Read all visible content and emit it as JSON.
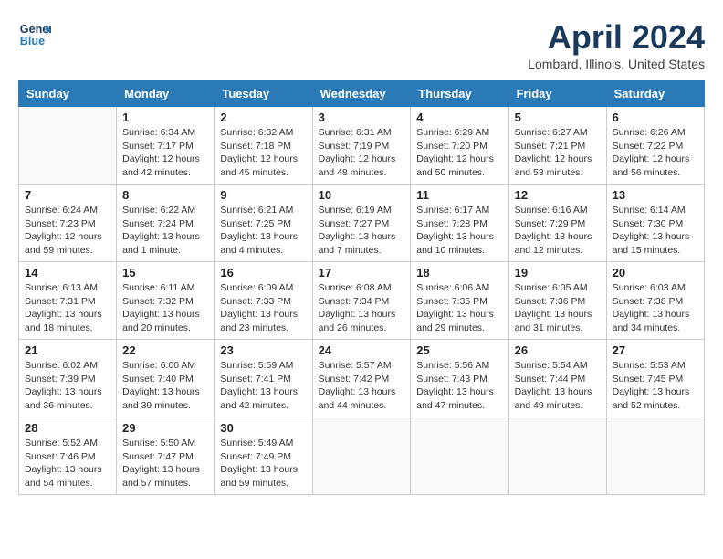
{
  "header": {
    "logo_line1": "General",
    "logo_line2": "Blue",
    "title": "April 2024",
    "location": "Lombard, Illinois, United States"
  },
  "days_of_week": [
    "Sunday",
    "Monday",
    "Tuesday",
    "Wednesday",
    "Thursday",
    "Friday",
    "Saturday"
  ],
  "weeks": [
    [
      {
        "num": "",
        "sunrise": "",
        "sunset": "",
        "daylight": ""
      },
      {
        "num": "1",
        "sunrise": "Sunrise: 6:34 AM",
        "sunset": "Sunset: 7:17 PM",
        "daylight": "Daylight: 12 hours and 42 minutes."
      },
      {
        "num": "2",
        "sunrise": "Sunrise: 6:32 AM",
        "sunset": "Sunset: 7:18 PM",
        "daylight": "Daylight: 12 hours and 45 minutes."
      },
      {
        "num": "3",
        "sunrise": "Sunrise: 6:31 AM",
        "sunset": "Sunset: 7:19 PM",
        "daylight": "Daylight: 12 hours and 48 minutes."
      },
      {
        "num": "4",
        "sunrise": "Sunrise: 6:29 AM",
        "sunset": "Sunset: 7:20 PM",
        "daylight": "Daylight: 12 hours and 50 minutes."
      },
      {
        "num": "5",
        "sunrise": "Sunrise: 6:27 AM",
        "sunset": "Sunset: 7:21 PM",
        "daylight": "Daylight: 12 hours and 53 minutes."
      },
      {
        "num": "6",
        "sunrise": "Sunrise: 6:26 AM",
        "sunset": "Sunset: 7:22 PM",
        "daylight": "Daylight: 12 hours and 56 minutes."
      }
    ],
    [
      {
        "num": "7",
        "sunrise": "Sunrise: 6:24 AM",
        "sunset": "Sunset: 7:23 PM",
        "daylight": "Daylight: 12 hours and 59 minutes."
      },
      {
        "num": "8",
        "sunrise": "Sunrise: 6:22 AM",
        "sunset": "Sunset: 7:24 PM",
        "daylight": "Daylight: 13 hours and 1 minute."
      },
      {
        "num": "9",
        "sunrise": "Sunrise: 6:21 AM",
        "sunset": "Sunset: 7:25 PM",
        "daylight": "Daylight: 13 hours and 4 minutes."
      },
      {
        "num": "10",
        "sunrise": "Sunrise: 6:19 AM",
        "sunset": "Sunset: 7:27 PM",
        "daylight": "Daylight: 13 hours and 7 minutes."
      },
      {
        "num": "11",
        "sunrise": "Sunrise: 6:17 AM",
        "sunset": "Sunset: 7:28 PM",
        "daylight": "Daylight: 13 hours and 10 minutes."
      },
      {
        "num": "12",
        "sunrise": "Sunrise: 6:16 AM",
        "sunset": "Sunset: 7:29 PM",
        "daylight": "Daylight: 13 hours and 12 minutes."
      },
      {
        "num": "13",
        "sunrise": "Sunrise: 6:14 AM",
        "sunset": "Sunset: 7:30 PM",
        "daylight": "Daylight: 13 hours and 15 minutes."
      }
    ],
    [
      {
        "num": "14",
        "sunrise": "Sunrise: 6:13 AM",
        "sunset": "Sunset: 7:31 PM",
        "daylight": "Daylight: 13 hours and 18 minutes."
      },
      {
        "num": "15",
        "sunrise": "Sunrise: 6:11 AM",
        "sunset": "Sunset: 7:32 PM",
        "daylight": "Daylight: 13 hours and 20 minutes."
      },
      {
        "num": "16",
        "sunrise": "Sunrise: 6:09 AM",
        "sunset": "Sunset: 7:33 PM",
        "daylight": "Daylight: 13 hours and 23 minutes."
      },
      {
        "num": "17",
        "sunrise": "Sunrise: 6:08 AM",
        "sunset": "Sunset: 7:34 PM",
        "daylight": "Daylight: 13 hours and 26 minutes."
      },
      {
        "num": "18",
        "sunrise": "Sunrise: 6:06 AM",
        "sunset": "Sunset: 7:35 PM",
        "daylight": "Daylight: 13 hours and 29 minutes."
      },
      {
        "num": "19",
        "sunrise": "Sunrise: 6:05 AM",
        "sunset": "Sunset: 7:36 PM",
        "daylight": "Daylight: 13 hours and 31 minutes."
      },
      {
        "num": "20",
        "sunrise": "Sunrise: 6:03 AM",
        "sunset": "Sunset: 7:38 PM",
        "daylight": "Daylight: 13 hours and 34 minutes."
      }
    ],
    [
      {
        "num": "21",
        "sunrise": "Sunrise: 6:02 AM",
        "sunset": "Sunset: 7:39 PM",
        "daylight": "Daylight: 13 hours and 36 minutes."
      },
      {
        "num": "22",
        "sunrise": "Sunrise: 6:00 AM",
        "sunset": "Sunset: 7:40 PM",
        "daylight": "Daylight: 13 hours and 39 minutes."
      },
      {
        "num": "23",
        "sunrise": "Sunrise: 5:59 AM",
        "sunset": "Sunset: 7:41 PM",
        "daylight": "Daylight: 13 hours and 42 minutes."
      },
      {
        "num": "24",
        "sunrise": "Sunrise: 5:57 AM",
        "sunset": "Sunset: 7:42 PM",
        "daylight": "Daylight: 13 hours and 44 minutes."
      },
      {
        "num": "25",
        "sunrise": "Sunrise: 5:56 AM",
        "sunset": "Sunset: 7:43 PM",
        "daylight": "Daylight: 13 hours and 47 minutes."
      },
      {
        "num": "26",
        "sunrise": "Sunrise: 5:54 AM",
        "sunset": "Sunset: 7:44 PM",
        "daylight": "Daylight: 13 hours and 49 minutes."
      },
      {
        "num": "27",
        "sunrise": "Sunrise: 5:53 AM",
        "sunset": "Sunset: 7:45 PM",
        "daylight": "Daylight: 13 hours and 52 minutes."
      }
    ],
    [
      {
        "num": "28",
        "sunrise": "Sunrise: 5:52 AM",
        "sunset": "Sunset: 7:46 PM",
        "daylight": "Daylight: 13 hours and 54 minutes."
      },
      {
        "num": "29",
        "sunrise": "Sunrise: 5:50 AM",
        "sunset": "Sunset: 7:47 PM",
        "daylight": "Daylight: 13 hours and 57 minutes."
      },
      {
        "num": "30",
        "sunrise": "Sunrise: 5:49 AM",
        "sunset": "Sunset: 7:49 PM",
        "daylight": "Daylight: 13 hours and 59 minutes."
      },
      {
        "num": "",
        "sunrise": "",
        "sunset": "",
        "daylight": ""
      },
      {
        "num": "",
        "sunrise": "",
        "sunset": "",
        "daylight": ""
      },
      {
        "num": "",
        "sunrise": "",
        "sunset": "",
        "daylight": ""
      },
      {
        "num": "",
        "sunrise": "",
        "sunset": "",
        "daylight": ""
      }
    ]
  ]
}
